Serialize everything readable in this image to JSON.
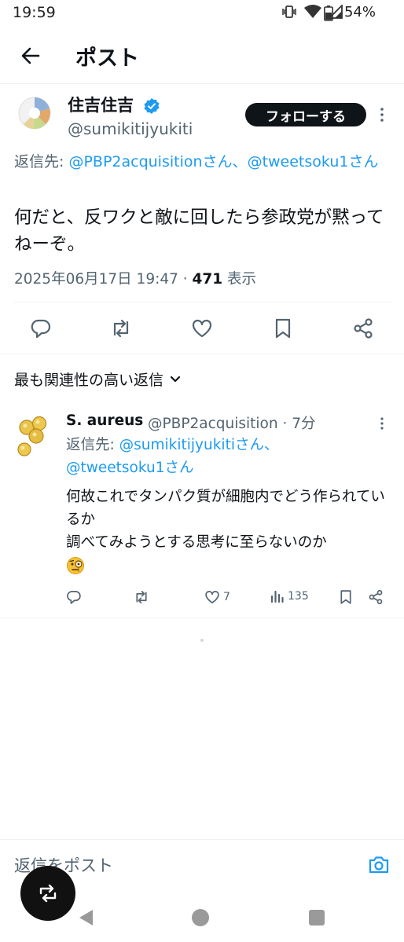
{
  "status_bar": {
    "time": "19:59",
    "battery": "54%"
  },
  "header": {
    "title": "ポスト"
  },
  "post": {
    "author_name": "住吉住吉",
    "author_handle": "@sumikitijyukiti",
    "follow_label": "フォローする",
    "reply_prefix": "返信先: ",
    "reply_mention_1": "@PBP2acquisitionさん",
    "reply_sep": "、",
    "reply_mention_2": "@tweetsoku1さん",
    "text": "何だと、反ワクと敵に回したら参政党が黙ってねーぞ。",
    "datetime": "2025年06月17日 19:47",
    "meta_sep": " · ",
    "views": "471",
    "views_label": " 表示"
  },
  "sort": {
    "label": "最も関連性の高い返信"
  },
  "reply": {
    "name": "S. aureus",
    "handle_time": "@PBP2acquisition · 7分",
    "reply_prefix": "返信先: ",
    "reply_mention_1": "@sumikitijyukitiさん",
    "reply_sep": "、",
    "reply_mention_2": "@tweetsoku1さん",
    "text_line1": "何故これでタンパク質が細胞内でどう作られているか",
    "text_line2": "調べてみようとする思考に至らないのか",
    "likes": "7",
    "views": "135"
  },
  "composer": {
    "placeholder": "返信をポスト"
  },
  "colors": {
    "accent": "#1d9bf0",
    "text": "#0f1419",
    "secondary": "#536471"
  }
}
